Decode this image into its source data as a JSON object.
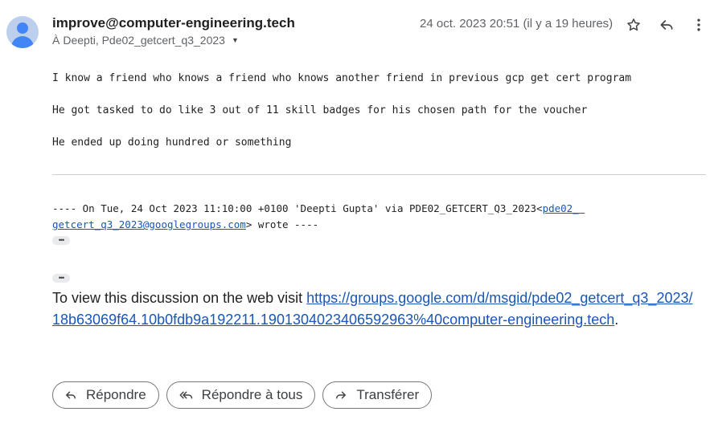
{
  "header": {
    "sender": "improve@computer-engineering.tech",
    "recipients_prefix": "À",
    "recipients": "Deepti, Pde02_getcert_q3_2023",
    "date": "24 oct. 2023 20:51 (il y a 19 heures)"
  },
  "icons": {
    "avatar": "person-avatar-icon",
    "star": "star-icon",
    "reply": "reply-icon",
    "more": "more-vert-icon"
  },
  "body": {
    "line1": "I know a friend who knows a friend who knows another friend in previous gcp get cert program",
    "line2": "He got tasked to do like 3 out of 11 skill badges for his chosen path for the voucher",
    "line3": "He ended up doing hundred or something"
  },
  "quote": {
    "prefix": "---- On Tue, 24 Oct 2023 11:10:00 +0100 'Deepti Gupta' via PDE02_GETCERT_Q3_2023<",
    "link_part1": "pde02_",
    "link_part2": "getcert_q3_2023@googlegroups.com",
    "suffix": "> wrote ----"
  },
  "footer": {
    "view_text": "To view this discussion on the web visit ",
    "link_line1": "https://groups.google.com/d/msgid/pde02_getcert_q3_2023/",
    "link_line2": "18b63069f64.10b0fdb9a192211.1901304023406592963%40computer-engineering.tech",
    "end": "."
  },
  "actions": {
    "reply": "Répondre",
    "reply_all": "Répondre à tous",
    "forward": "Transférer"
  }
}
